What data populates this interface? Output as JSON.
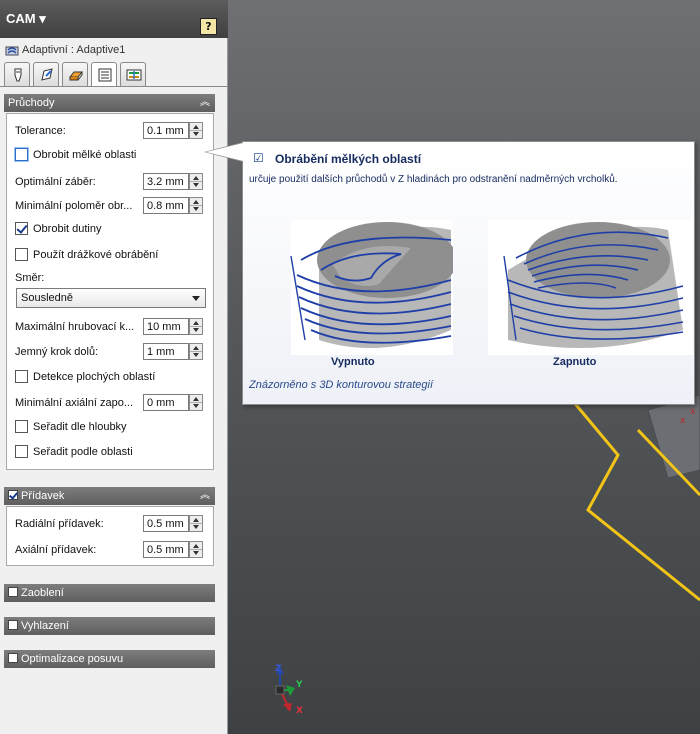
{
  "header": {
    "title": "CAM ▾",
    "help_label": "?"
  },
  "operation": {
    "name": "Adaptivní : Adaptive1"
  },
  "tabs": [
    {
      "icon": "tool-icon"
    },
    {
      "icon": "geometry-icon"
    },
    {
      "icon": "heights-icon"
    },
    {
      "icon": "passes-icon",
      "active": true
    },
    {
      "icon": "linking-icon"
    }
  ],
  "passes": {
    "title": "Průchody",
    "tolerance_label": "Tolerance:",
    "tolerance_value": "0.1 mm",
    "shallow_label": "Obrobit mělké oblasti",
    "shallow_checked": false,
    "engagement_label": "Optimální záběr:",
    "engagement_value": "3.2 mm",
    "min_radius_label": "Minimální poloměr obr...",
    "min_radius_value": "0.8 mm",
    "cavities_label": "Obrobit dutiny",
    "cavities_checked": true,
    "slot_label": "Použít drážkové obrábění",
    "slot_checked": false,
    "direction_label": "Směr:",
    "direction_value": "Sousledně",
    "max_stepdown_label": "Maximální hrubovací k...",
    "max_stepdown_value": "10 mm",
    "fine_stepdown_label": "Jemný krok dolů:",
    "fine_stepdown_value": "1 mm",
    "flat_detect_label": "Detekce plochých oblastí",
    "flat_detect_checked": false,
    "min_axial_label": "Minimální axiální zapo...",
    "min_axial_value": "0 mm",
    "order_depth_label": "Seřadit dle hloubky",
    "order_depth_checked": false,
    "order_area_label": "Seřadit podle oblasti",
    "order_area_checked": false
  },
  "stock": {
    "title": "Přídavek",
    "checked": true,
    "radial_label": "Radiální přídavek:",
    "radial_value": "0.5 mm",
    "axial_label": "Axiální přídavek:",
    "axial_value": "0.5 mm"
  },
  "sections": {
    "fillets": "Zaoblení",
    "smoothing": "Vyhlazení",
    "feed_opt": "Optimalizace posuvu"
  },
  "tooltip": {
    "check": "☑",
    "title": "Obrábění mělkých oblastí",
    "description": "určuje použití dalších průchodů v Z hladinách pro odstranění nadměrných vrcholků.",
    "caption_off": "Vypnuto",
    "caption_on": "Zapnuto",
    "note": "Znázorněno s 3D konturovou strategií"
  },
  "axes": {
    "z": "Z",
    "y": "Y",
    "x": "X"
  },
  "colors": {
    "toolpath": "#1f3fa8",
    "edge": "#f2c417",
    "header": "#505050"
  }
}
